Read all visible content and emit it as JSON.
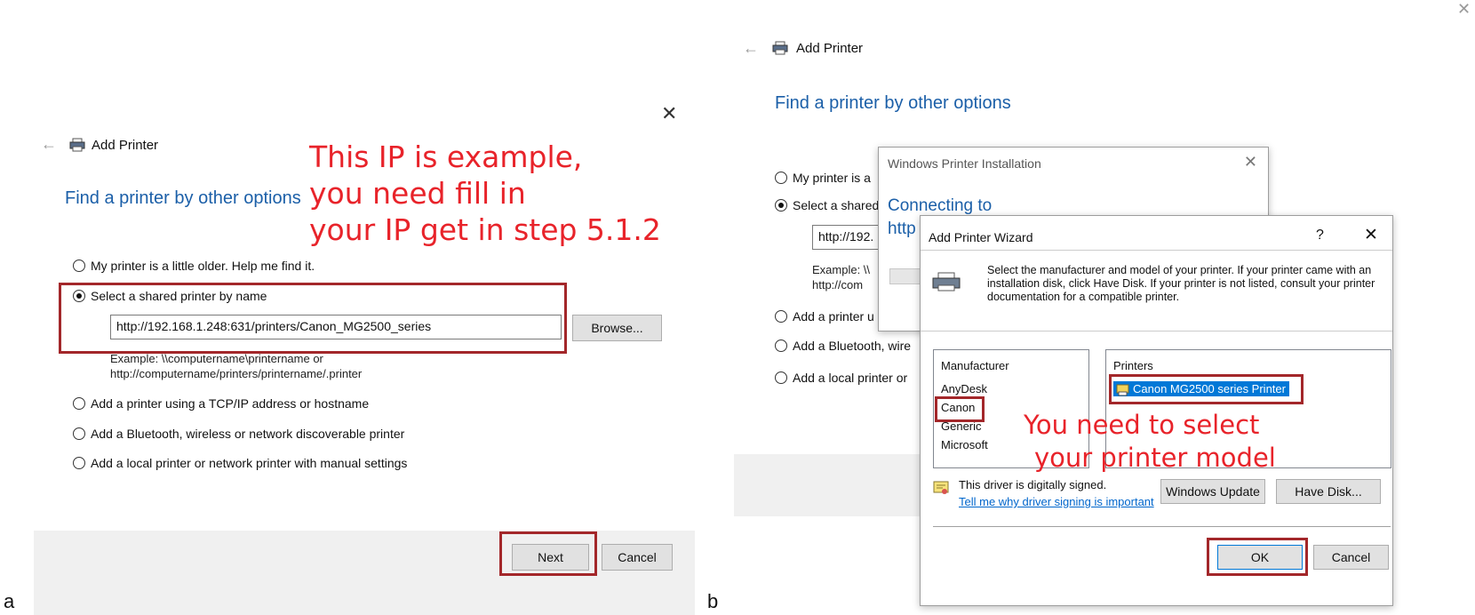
{
  "panel_a": {
    "label": "a",
    "window_title": "Add Printer",
    "heading": "Find a printer by other options",
    "options": [
      "My printer is a little older. Help me find it.",
      "Select a shared printer by name",
      "Add a printer using a TCP/IP address or hostname",
      "Add a Bluetooth, wireless or network discoverable printer",
      "Add a local printer or network printer with manual settings"
    ],
    "url_value": "http://192.168.1.248:631/printers/Canon_MG2500_series",
    "browse_label": "Browse...",
    "example_line1": "Example: \\\\computername\\printername or",
    "example_line2": "http://computername/printers/printername/.printer",
    "next_label": "Next",
    "cancel_label": "Cancel",
    "annotation_lines": [
      "This IP is example,",
      "you need fill in",
      "your IP get in step 5.1.2"
    ]
  },
  "panel_b": {
    "label": "b",
    "window_title": "Add Printer",
    "heading": "Find a printer by other options",
    "options_truncated": [
      "My printer is a",
      "Select a shared",
      "Add a printer u",
      "Add a Bluetooth, wire",
      "Add a local printer or"
    ],
    "url_truncated": "http://192.",
    "example_line1": "Example: \\\\",
    "example_line2": "http://com",
    "installation_dialog": {
      "title": "Windows Printer Installation",
      "connecting": "Connecting to",
      "url_fragment": "http"
    },
    "wizard": {
      "title": "Add Printer Wizard",
      "help": "?",
      "instructions": "Select the manufacturer and model of your printer. If your printer came with an installation disk, click Have Disk. If your printer is not listed, consult your printer documentation for a compatible printer.",
      "manufacturer_header": "Manufacturer",
      "manufacturers": [
        "AnyDesk",
        "Canon",
        "Generic",
        "Microsoft"
      ],
      "printers_header": "Printers",
      "printers": [
        "Canon MG2500 series Printer"
      ],
      "signed_text": "This driver is digitally signed.",
      "signing_link": "Tell me why driver signing is important",
      "windows_update_label": "Windows Update",
      "have_disk_label": "Have Disk...",
      "ok_label": "OK",
      "cancel_label": "Cancel"
    },
    "annotation_lines": [
      "You need to select",
      "your printer model"
    ]
  },
  "colors": {
    "heading_blue": "#1b5fa8",
    "annotation_red": "#e8232a",
    "highlight_box": "#a3272a",
    "selection_blue": "#0078d7"
  }
}
